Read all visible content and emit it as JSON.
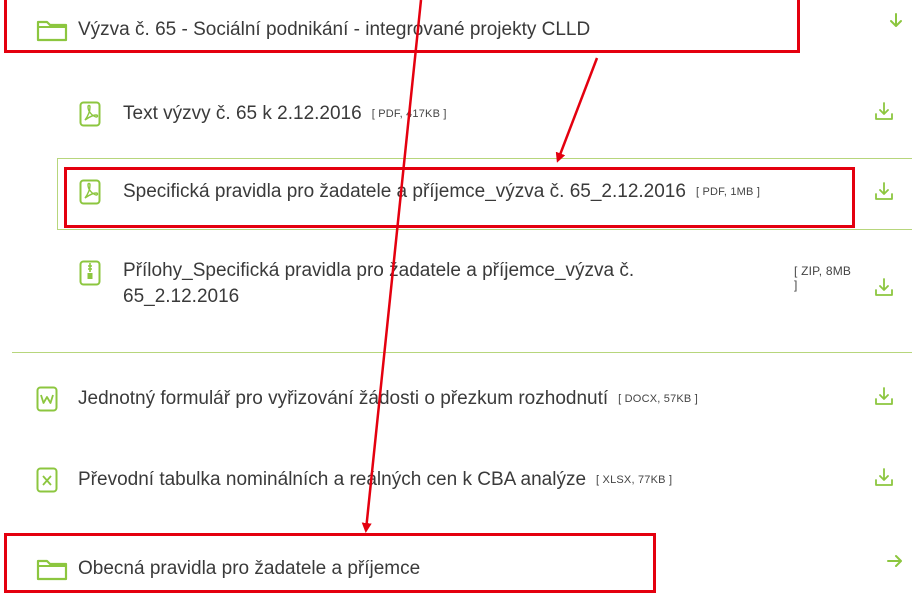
{
  "folders": [
    {
      "label": "Výzva č. 65 - Sociální podnikání - integrované projekty CLLD",
      "icon": "folder-icon",
      "action_icon": "arrow-down-icon"
    },
    {
      "label": "Obecná pravidla pro žadatele a příjemce",
      "icon": "folder-icon",
      "action_icon": "arrow-right-icon"
    }
  ],
  "files": [
    {
      "label": "Text výzvy č. 65 k 2.12.2016",
      "meta": "[ PDF, 417KB ]",
      "icon": "pdf-file-icon"
    },
    {
      "label": "Specifická pravidla pro žadatele a příjemce_výzva č. 65_2.12.2016",
      "meta": "[ PDF, 1MB ]",
      "icon": "pdf-file-icon"
    },
    {
      "label_line1": "Přílohy_Specifická pravidla pro žadatele a příjemce_výzva č.",
      "label_line2": "65_2.12.2016",
      "meta_line1": "[ ZIP, 8MB",
      "meta_line2": "]",
      "icon": "zip-file-icon"
    },
    {
      "label": "Jednotný formulář pro vyřizování žádosti o přezkum rozhodnutí",
      "meta": "[ DOCX, 57KB ]",
      "icon": "docx-file-icon"
    },
    {
      "label": "Převodní tabulka nominálních a reálných cen k CBA analýze",
      "meta": "[ XLSX, 77KB ]",
      "icon": "xlsx-file-icon"
    }
  ],
  "colors": {
    "accent": "#8cc63f",
    "highlight": "#e4000f",
    "arrow": "#e4000f",
    "text": "#3a3a3a"
  }
}
